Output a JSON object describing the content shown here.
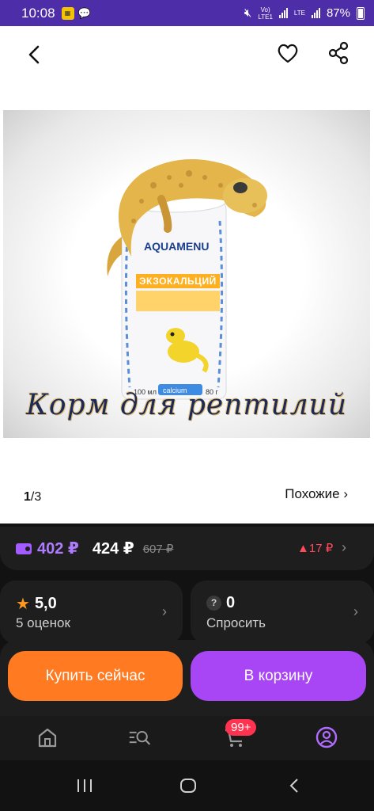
{
  "status_bar": {
    "time": "10:08",
    "network_label": "VoLTE1",
    "lte_label": "LTE",
    "battery": "87%"
  },
  "top_bar": {
    "icons": [
      "back-arrow-icon",
      "heart-icon",
      "share-icon"
    ]
  },
  "product_image": {
    "caption": "Корм для рептилий",
    "brand": "AQUAMENU",
    "product_name": "ЭКЗОКАЛЬЦИЙ",
    "volume": "100 мл",
    "weight": "80 г",
    "tag": "calcium"
  },
  "gallery": {
    "current": "1",
    "separator": "/",
    "total": "3",
    "similar_label": "Похожие ›"
  },
  "price": {
    "wallet_price": "402 ₽",
    "price": "424 ₽",
    "old_price": "607 ₽",
    "delta": "▲17 ₽"
  },
  "rating": {
    "value": "5,0",
    "count_label": "5 оценок"
  },
  "questions": {
    "count": "0",
    "label": "Спросить"
  },
  "actions": {
    "buy_now": "Купить сейчас",
    "add_to_cart": "В корзину"
  },
  "bottom_nav": {
    "cart_badge": "99+",
    "items": [
      "home-icon",
      "catalog-search-icon",
      "cart-icon",
      "profile-icon"
    ]
  },
  "colors": {
    "status_bar": "#4e2ea8",
    "accent_purple": "#a845f5",
    "accent_orange": "#ff7a21",
    "wallet_price": "#b07cff",
    "price_delta": "#ff4b5c",
    "panel_bg": "#121212"
  }
}
